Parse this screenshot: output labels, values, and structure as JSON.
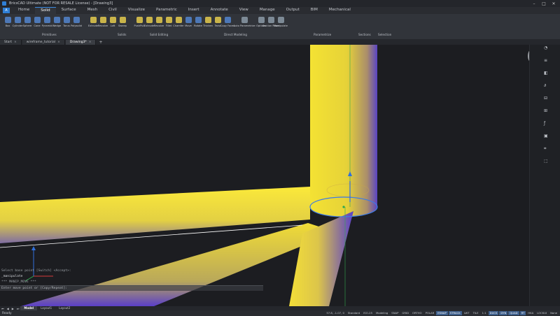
{
  "window": {
    "title": "BricsCAD Ultimate (NOT FOR RESALE License) - [Drawing3]",
    "controls": [
      "–",
      "□",
      "✕"
    ]
  },
  "ribbon": {
    "app_button": "A",
    "tabs": [
      "Home",
      "Solid",
      "Surface",
      "Mesh",
      "Civil",
      "Visualize",
      "Parametric",
      "Insert",
      "Annotate",
      "View",
      "Manage",
      "Output",
      "BIM",
      "Mechanical"
    ],
    "active_tab": "Solid",
    "tools": [
      {
        "label": "Box",
        "icon": "box-icon"
      },
      {
        "label": "Cylinder",
        "icon": "cylinder-icon"
      },
      {
        "label": "Sphere",
        "icon": "sphere-icon"
      },
      {
        "label": "Cone",
        "icon": "cone-icon"
      },
      {
        "label": "Pyramid",
        "icon": "pyramid-icon"
      },
      {
        "label": "Wedge",
        "icon": "wedge-icon"
      },
      {
        "label": "Torus",
        "icon": "torus-icon"
      },
      {
        "label": "Polysolid",
        "icon": "polysolid-icon"
      },
      {
        "label": "Extrude",
        "icon": "extrude-icon"
      },
      {
        "label": "Revolve",
        "icon": "revolve-icon"
      },
      {
        "label": "Loft",
        "icon": "loft-icon"
      },
      {
        "label": "Sweep",
        "icon": "sweep-icon"
      },
      {
        "label": "PushPull",
        "icon": "pushpull-icon"
      },
      {
        "label": "Extrude",
        "icon": "extrude-icon"
      },
      {
        "label": "Revolve",
        "icon": "revolve-icon"
      },
      {
        "label": "Fillet",
        "icon": "fillet-icon"
      },
      {
        "label": "Chamfer",
        "icon": "chamfer-icon"
      },
      {
        "label": "Move",
        "icon": "move-icon"
      },
      {
        "label": "Rotate",
        "icon": "rotate-icon"
      },
      {
        "label": "Thicken",
        "icon": "thicken-icon"
      },
      {
        "label": "Twist",
        "icon": "twist-icon"
      },
      {
        "label": "Copy Faces",
        "icon": "copy-faces-icon"
      },
      {
        "label": "Auto Parametrize",
        "icon": "auto-parametrize-icon"
      },
      {
        "label": "Options",
        "icon": "options-icon"
      },
      {
        "label": "Section Plane",
        "icon": "section-plane-icon"
      },
      {
        "label": "Manipulate",
        "icon": "manipulate-icon"
      }
    ],
    "groups": [
      "Primitives",
      "Solids",
      "Solid Editing",
      "Direct Modeling",
      "Parametrize",
      "Sections",
      "Selection"
    ]
  },
  "doc_tabs": [
    {
      "label": "Start",
      "active": false
    },
    {
      "label": "wireframe_tutorial",
      "active": false
    },
    {
      "label": "Drawing3*",
      "active": true
    }
  ],
  "command_line": {
    "history": [
      "Select base point [Switch] <Accept>:",
      "_manipulate",
      "*** MANIP_MOVE ***"
    ],
    "prompt": "Enter move point or [Copy/Repeat]:"
  },
  "layout_tabs": [
    "Model",
    "Layout1",
    "Layout2"
  ],
  "status": {
    "ready": "Ready",
    "coords": "57.8, -1.07, 0",
    "items": [
      "Standard",
      "ISO-25",
      "Modeling",
      "SNAP",
      "GRID",
      "ORTHO",
      "POLAR",
      "ESNAP",
      "STRACK",
      "LWT",
      "TILE",
      "1:1",
      "DUCS",
      "DYN",
      "QUAD",
      "RT",
      "HKA",
      "LOCKUI",
      "None"
    ],
    "active": [
      "ESNAP",
      "STRACK",
      "DUCS",
      "DYN",
      "QUAD",
      "RT"
    ]
  },
  "colors": {
    "pipe_yellow": "#f2df35",
    "pipe_blue": "#5a3fc8",
    "axis_blue": "#2f6fdb",
    "axis_green": "#2fa84f",
    "axis_red": "#d63a3a"
  }
}
